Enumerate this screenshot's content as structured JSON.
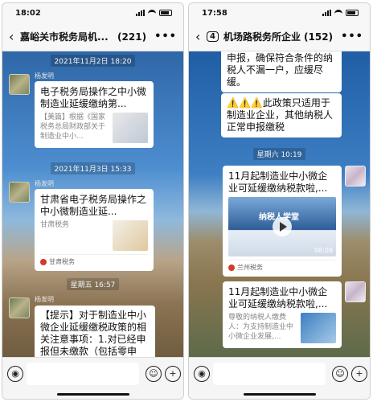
{
  "panels": [
    {
      "status": {
        "time": "18:02"
      },
      "header": {
        "unread": "",
        "title": "嘉峪关市税务局机...",
        "count": "(221)"
      },
      "stamps": [
        "2021年11月2日 18:20",
        "2021年11月3日 15:33",
        "星期五 16:57"
      ],
      "nicks": [
        "杨发明",
        "杨发明",
        "杨发明"
      ],
      "msg1": {
        "title": "电子税务局操作之中小微制造业延缓缴纳第...",
        "desc": "【美篇】根据《国家税务总局财政部关于制造业中小..."
      },
      "msg2": {
        "title": "甘肃省电子税务局操作之中小微制造业延...",
        "desc": "甘肃税务",
        "source": "甘肃税务"
      },
      "msg3": {
        "text": "【提示】对于制造业中小微企业延缓缴税政策的相关注意事项：1.对已经申报但未缴款（包括零申报）的纳税"
      }
    },
    {
      "status": {
        "time": "17:58"
      },
      "header": {
        "unread": "4",
        "title": "机场路税务所企业...",
        "count": "(152)"
      },
      "stamps": [
        "星期六 10:19"
      ],
      "top": {
        "text": "申报，确保符合条件的纳税人不漏一户，应缓尽缓。"
      },
      "warn": {
        "text": "⚠️⚠️⚠️此政策只适用于制造业企业，其他纳税人正常申报缴税"
      },
      "video": {
        "title": "11月起制造业中小微企业可延缓缴纳税款啦,...",
        "source": "兰州税务",
        "duration": "08:09",
        "thumb_heading": "纳税人学堂"
      },
      "card": {
        "title": "11月起制造业中小微企业可延缓缴纳税款啦,...",
        "desc": "尊敬的纳税人缴费人：为支持制造业中小微企业发展,..."
      }
    }
  ]
}
